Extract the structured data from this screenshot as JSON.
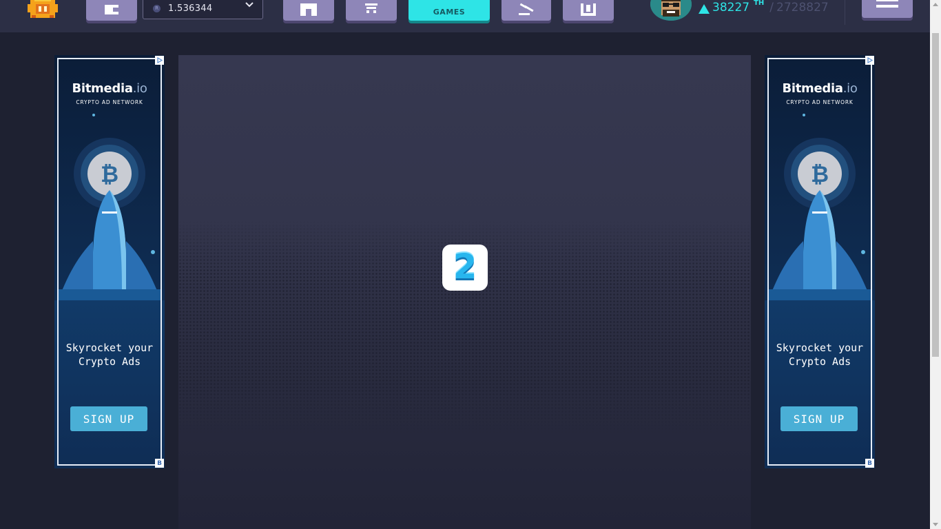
{
  "header": {
    "balance": "1.536344",
    "nav": {
      "games_label": "GAMES"
    },
    "power": {
      "current": "38227",
      "unit": "TH",
      "separator": "/",
      "total": "2728827"
    },
    "icons": {
      "logo": "game-logo-icon",
      "wallet": "wallet-icon",
      "coin": "rlt-coin-icon",
      "home": "home-icon",
      "market": "cart-icon",
      "games": "gamepad-icon",
      "auction": "gavel-icon",
      "storage": "storage-icon",
      "menu": "hamburger-menu-icon"
    }
  },
  "ads": {
    "left": {
      "brand": "Bitmedia",
      "brand_suffix": ".io",
      "tagline": "CRYPTO AD NETWORK",
      "headline": "Skyrocket your Crypto Ads",
      "cta": "SIGN UP",
      "badge": "B"
    },
    "right": {
      "brand": "Bitmedia",
      "brand_suffix": ".io",
      "tagline": "CRYPTO AD NETWORK",
      "headline": "Skyrocket your Crypto Ads",
      "cta": "SIGN UP",
      "badge": "B"
    }
  },
  "game": {
    "countdown": "2"
  },
  "colors": {
    "accent": "#2ee4e6",
    "nav_button": "#8e86b8",
    "header_bg": "#2c2f45",
    "page_bg": "#1e2131",
    "ad_cta": "#4aafd6"
  }
}
